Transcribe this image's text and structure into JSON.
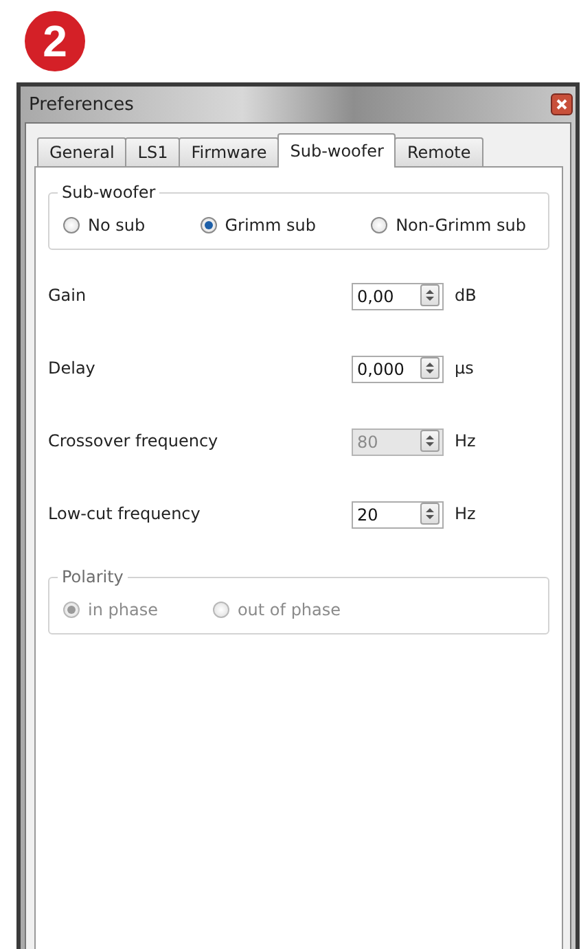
{
  "badge": "2",
  "window": {
    "title": "Preferences"
  },
  "tabs": [
    {
      "label": "General",
      "selected": false
    },
    {
      "label": "LS1",
      "selected": false
    },
    {
      "label": "Firmware",
      "selected": false
    },
    {
      "label": "Sub-woofer",
      "selected": true
    },
    {
      "label": "Remote",
      "selected": false
    }
  ],
  "subwoofer_group": {
    "title": "Sub-woofer",
    "disabled": false,
    "options": [
      {
        "label": "No sub",
        "selected": false
      },
      {
        "label": "Grimm sub",
        "selected": true
      },
      {
        "label": "Non-Grimm sub",
        "selected": false
      }
    ]
  },
  "fields": [
    {
      "label": "Gain",
      "value": "0,00",
      "unit": "dB",
      "disabled": false
    },
    {
      "label": "Delay",
      "value": "0,000",
      "unit": "µs",
      "disabled": false
    },
    {
      "label": "Crossover frequency",
      "value": "80",
      "unit": "Hz",
      "disabled": true
    },
    {
      "label": "Low-cut frequency",
      "value": "20",
      "unit": "Hz",
      "disabled": false
    }
  ],
  "polarity_group": {
    "title": "Polarity",
    "disabled": true,
    "options": [
      {
        "label": "in phase",
        "selected": true
      },
      {
        "label": "out of phase",
        "selected": false
      }
    ]
  }
}
